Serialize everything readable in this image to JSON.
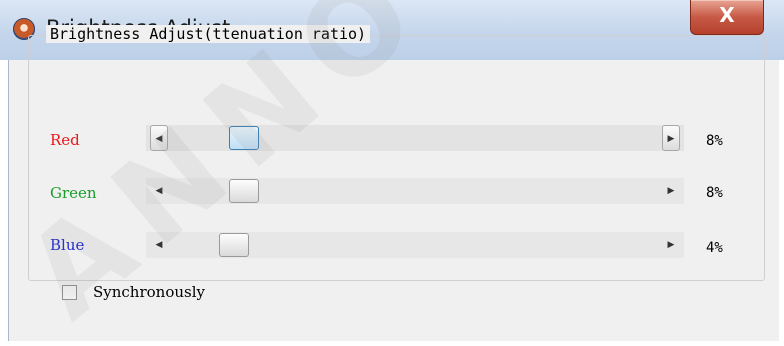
{
  "window": {
    "title": "Brightness Adjust",
    "close_label": "X",
    "icon": "app-shield-icon"
  },
  "group": {
    "title": "Brightness Adjust(ttenuation ratio)"
  },
  "channels": [
    {
      "label": "Red",
      "color": "#e8191b",
      "value_text": "8%",
      "fraction": 0.08,
      "focused": true,
      "left_arrow": "◀",
      "right_arrow": "▶"
    },
    {
      "label": "Green",
      "color": "#1b9e2a",
      "value_text": "8%",
      "fraction": 0.08,
      "focused": false,
      "left_arrow": "◀",
      "right_arrow": "▶"
    },
    {
      "label": "Blue",
      "color": "#1c24d0",
      "value_text": "4%",
      "fraction": 0.04,
      "focused": false,
      "left_arrow": "◀",
      "right_arrow": "▶"
    }
  ],
  "sync": {
    "label": "Synchronously",
    "checked": false
  },
  "watermark": "ANNO"
}
